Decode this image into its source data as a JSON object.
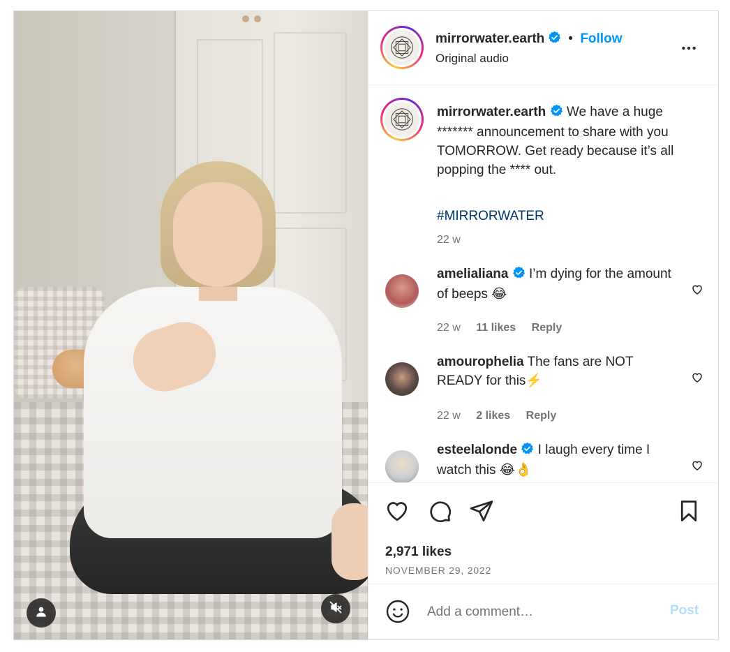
{
  "post": {
    "author": {
      "username": "mirrorwater.earth",
      "verified": true,
      "follow_label": "Follow",
      "separator": "•",
      "audio_label": "Original audio"
    },
    "more_icon": "more-horizontal-icon",
    "caption": {
      "username": "mirrorwater.earth",
      "text": "We have a huge ******* announcement to share with you TOMORROW. Get ready because it’s all popping the **** out.",
      "hashtag": "#MIRRORWATER",
      "age": "22 w"
    },
    "comments": [
      {
        "username": "amelialiana",
        "verified": true,
        "text": "I’m dying for the amount of beeps 😂",
        "age": "22 w",
        "likes": "11 likes",
        "reply_label": "Reply",
        "avatar_color": "#c76b6b"
      },
      {
        "username": "amourophelia",
        "verified": false,
        "text": "The fans are NOT READY for this⚡️",
        "age": "22 w",
        "likes": "2 likes",
        "reply_label": "Reply",
        "avatar_color": "#5b4a44"
      },
      {
        "username": "esteelalonde",
        "verified": true,
        "text": "I laugh every time I watch this 😂👌",
        "age": "",
        "likes": "",
        "reply_label": "",
        "avatar_color": "#9aa3a8"
      }
    ],
    "likes_count": "2,971 likes",
    "date": "NOVEMBER 29, 2022",
    "add_comment": {
      "placeholder": "Add a comment…",
      "post_label": "Post"
    },
    "colors": {
      "accent": "#0095f6",
      "post_disabled": "#b2dffc",
      "verified": "#0095f6",
      "hashtag": "#00376b"
    },
    "icons": {
      "like": "heart-icon",
      "comment": "comment-icon",
      "share": "send-icon",
      "save": "bookmark-icon",
      "emoji": "emoji-icon",
      "user_tag": "user-icon",
      "mute": "speaker-muted-icon"
    }
  }
}
